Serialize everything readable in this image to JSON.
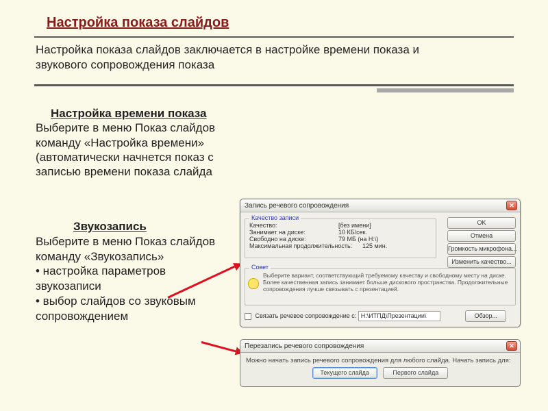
{
  "title": "Настройка показа слайдов",
  "intro": "Настройка показа слайдов заключается в настройке времени показа и звукового сопровождения показа",
  "section1": {
    "heading": "Настройка времени показа",
    "body": "Выберите в меню Показ слайдов команду «Настройка времени» (автоматически начнется показ с записью времени показа слайда"
  },
  "section2": {
    "heading": "Звукозапись",
    "body": "Выберите в меню Показ слайдов команду «Звукозапись»",
    "bullet1": "• настройка параметров звукозаписи",
    "bullet2": "• выбор слайдов со звуковым сопровождением"
  },
  "dialog1": {
    "title": "Запись речевого сопровождения",
    "group_quality": "Качество записи",
    "rows": {
      "quality_k": "Качество:",
      "quality_v": "[без имени]",
      "disk_k": "Занимает на диске:",
      "disk_v": "10 КБ/сек.",
      "free_k": "Свободно на диске:",
      "free_v": "79 МБ (на H:\\)",
      "dur_k": "Максимальная продолжительность:",
      "dur_v": "125 мин."
    },
    "buttons": {
      "ok": "OK",
      "cancel": "Отмена",
      "mic": "Громкость микрофона...",
      "chq": "Изменить качество..."
    },
    "tip_legend": "Совет",
    "tip": "Выберите вариант, соответствующий требуемому качеству и свободному месту на диске. Более качественная запись занимает больше дискового пространства. Продолжительные сопровождения лучше связывать с презентацией.",
    "link_label": "Связать речевое сопровождение с:",
    "link_path": "H:\\ИТПД\\Презентации\\",
    "browse": "Обзор..."
  },
  "dialog2": {
    "title": "Перезапись речевого сопровождения",
    "body": "Можно начать запись речевого сопровождения для любого слайда.  Начать запись для:",
    "btn_current": "Текущего слайда",
    "btn_first": "Первого слайда"
  }
}
